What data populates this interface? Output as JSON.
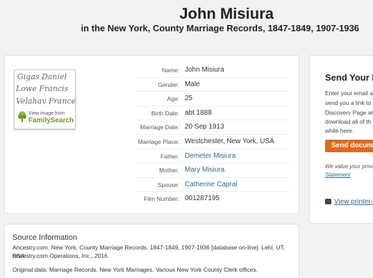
{
  "header": {
    "name": "John Misiura",
    "collection": "in the New York, County Marriage Records, 1847-1849, 1907-1936"
  },
  "thumbnail": {
    "handwriting": [
      "Gigas Daniel",
      "Lowe Francis",
      "Velahay Frances"
    ],
    "view_text": "View image from",
    "brand": "FamilySearch"
  },
  "record": {
    "rows": [
      {
        "label": "Name:",
        "value": "John Misiura"
      },
      {
        "label": "Gender:",
        "value": "Male"
      },
      {
        "label": "Age:",
        "value": "25"
      },
      {
        "label": "Birth Date:",
        "value": "abt 1888"
      },
      {
        "label": "Marriage Date:",
        "value": "20 Sep 1913"
      },
      {
        "label": "Marriage Place:",
        "value": "Westchester, New York, USA"
      },
      {
        "label": "Father:",
        "value": "Demeter Misiura"
      },
      {
        "label": "Mother:",
        "value": "Mary Misiura"
      },
      {
        "label": "Spouse:",
        "value": "Catherine Capral"
      },
      {
        "label": "Film Number:",
        "value": "001287195"
      }
    ]
  },
  "source": {
    "title": "Source Information",
    "line1": "Ancestry.com. New York, County Marriage Records, 1847-1849, 1907-1936 [database on-line]. Lehi, UT, USA:",
    "line2": "Ancestry.com Operations, Inc., 2016.",
    "line3": "Original data: Marriage Records. New York Marriages. Various New York County Clerk offices."
  },
  "send": {
    "title": "Send Your F",
    "lines": [
      "Enter your email a",
      "send you a link to",
      "Discovery Page wh",
      "download all of th",
      "while here."
    ],
    "button": "Send docum",
    "note1": "We value your privac",
    "note2": "Statement",
    "print": "View printer-"
  }
}
